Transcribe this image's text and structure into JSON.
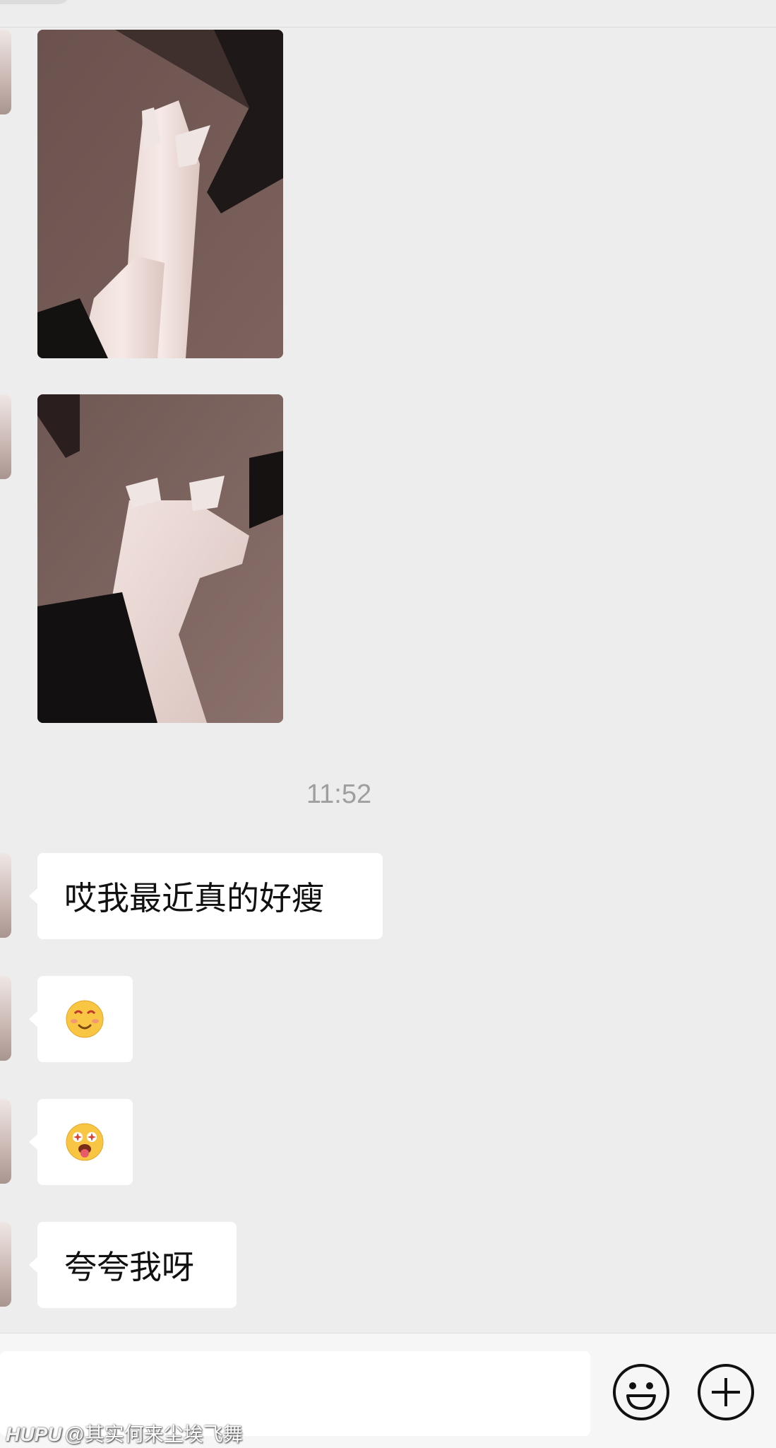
{
  "conversation": {
    "timestamp": "11:52",
    "messages": [
      {
        "type": "image",
        "label": "photo-message-1"
      },
      {
        "type": "image",
        "label": "photo-message-2"
      },
      {
        "type": "text",
        "text": "哎我最近真的好瘦"
      },
      {
        "type": "emoji",
        "emoji": "flushed-smile-emoji"
      },
      {
        "type": "emoji",
        "emoji": "starstruck-tongue-emoji"
      },
      {
        "type": "text",
        "text": "夸夸我呀"
      }
    ]
  },
  "input_bar": {
    "placeholder": "",
    "emoji_button_icon": "smiley-icon",
    "more_button_icon": "plus-circle-icon"
  },
  "watermark": {
    "logo": "HUPU",
    "handle": "@其实何来尘埃飞舞"
  },
  "colors": {
    "background": "#ededed",
    "bubble": "#ffffff",
    "timestamp": "#9f9f9f",
    "input_bar": "#f6f6f6"
  }
}
